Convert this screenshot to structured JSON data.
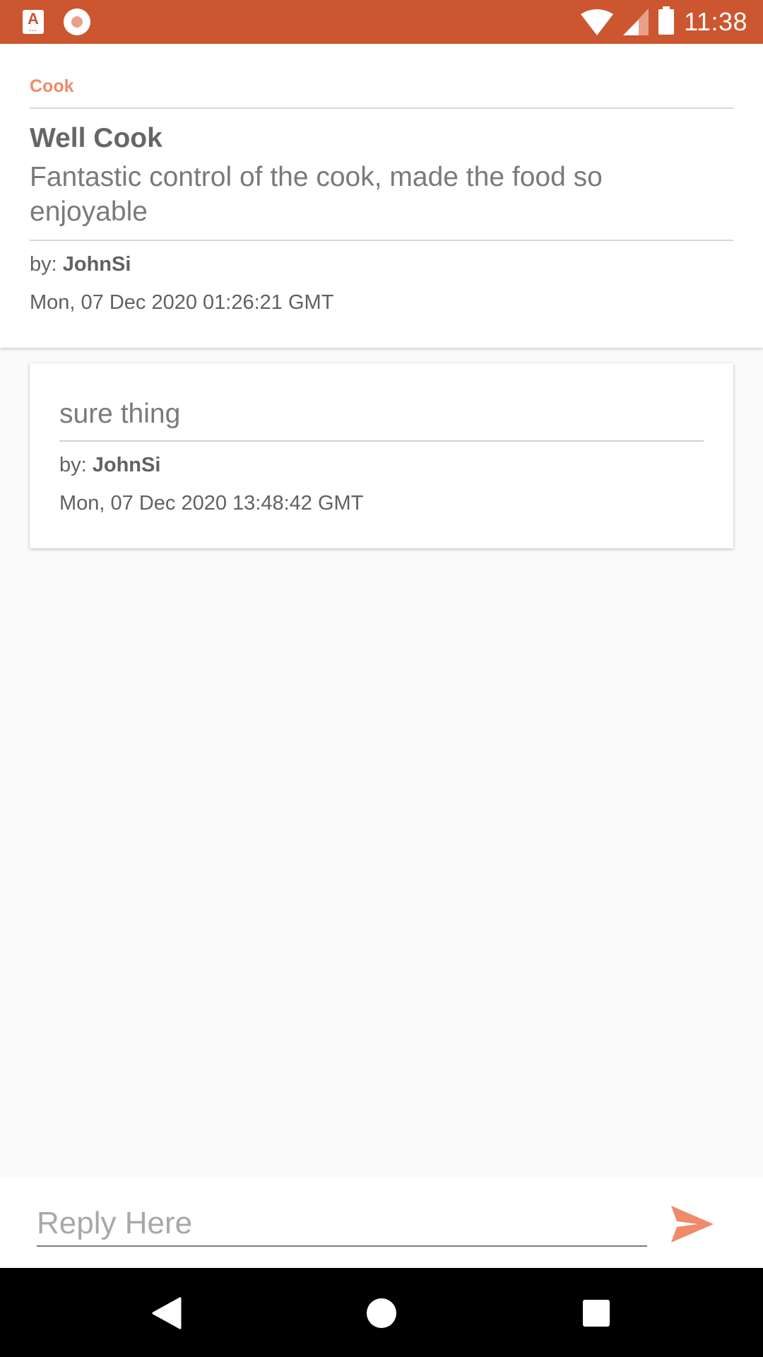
{
  "status_bar": {
    "time": "11:38",
    "app_icon_letter": "A",
    "app_icon_dots": "...",
    "icons": [
      "app-notification-icon",
      "record-icon",
      "wifi-icon",
      "signal-icon",
      "battery-icon"
    ]
  },
  "review": {
    "category": "Cook",
    "title": "Well Cook",
    "body": "Fantastic control of the cook, made the food so enjoyable",
    "author_prefix": "by: ",
    "author": "JohnSi",
    "date": "Mon, 07 Dec 2020 01:26:21 GMT"
  },
  "replies": [
    {
      "text": "sure thing",
      "author_prefix": "by: ",
      "author": "JohnSi",
      "date": "Mon, 07 Dec 2020 13:48:42 GMT"
    }
  ],
  "input": {
    "placeholder": "Reply Here",
    "value": ""
  },
  "nav_bar": {
    "icons": [
      "back-icon",
      "home-icon",
      "recents-icon"
    ]
  },
  "colors": {
    "status_bar": "#cb5630",
    "accent": "#ef8a6a",
    "send_icon": "#ef8a6a",
    "background": "#fafafa"
  }
}
